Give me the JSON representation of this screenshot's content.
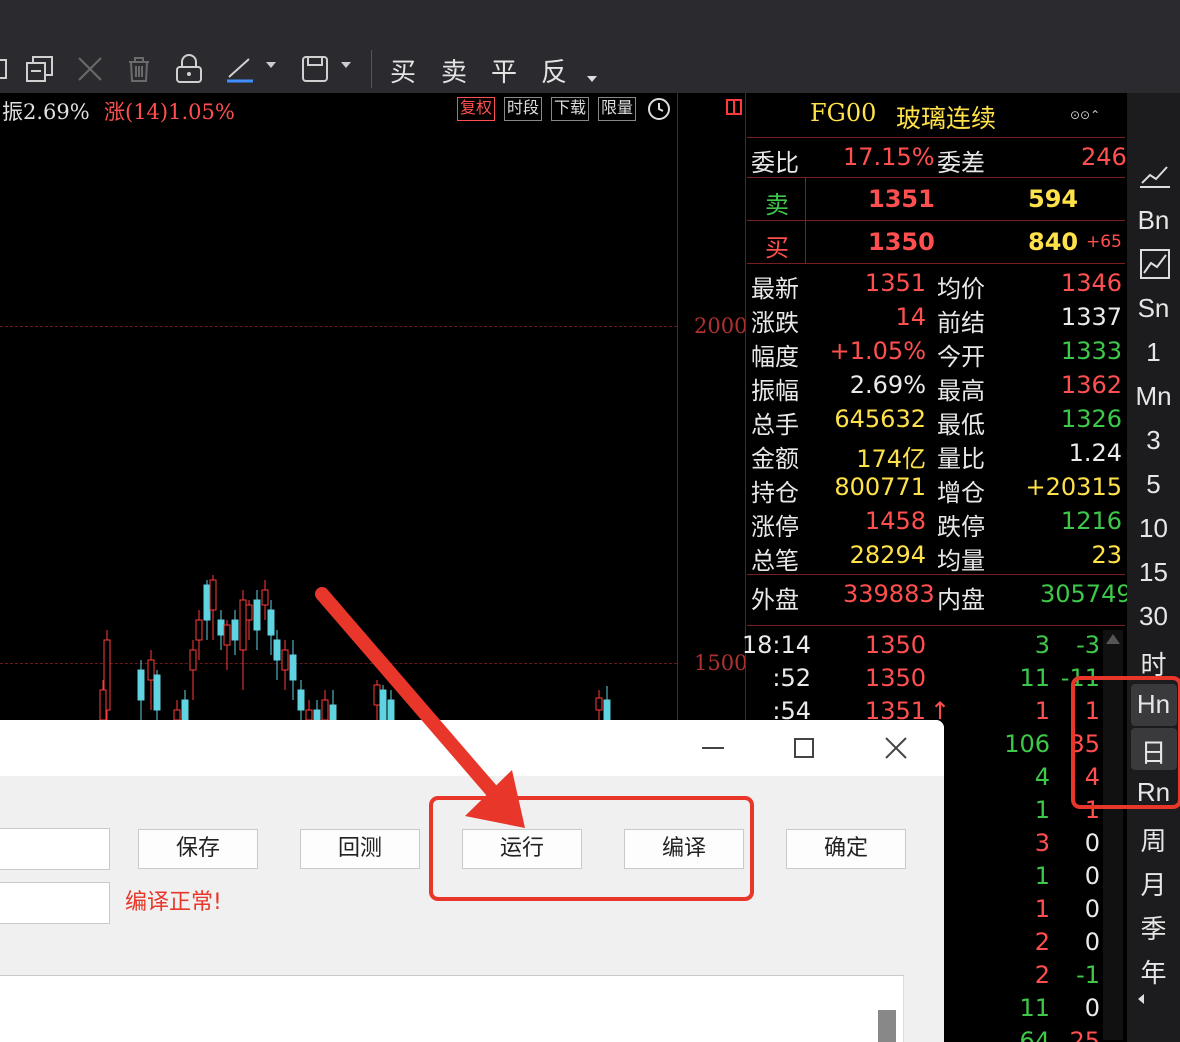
{
  "toolbar": {
    "trade_buttons": [
      "买",
      "卖",
      "平",
      "反"
    ]
  },
  "chart": {
    "amplitude_text": "振2.69%",
    "change_text": "涨(14)1.05%",
    "controls": [
      "复权",
      "时段",
      "下载",
      "限量"
    ],
    "y_labels": [
      "2000",
      "1500"
    ]
  },
  "quote": {
    "symbol": "FG00",
    "name": "玻璃连续",
    "webi_label": "委比",
    "webi_value": "17.15%",
    "weicha_label": "委差",
    "weicha_value": "246",
    "sell_label": "卖",
    "sell_price": "1351",
    "sell_volume": "594",
    "buy_label": "买",
    "buy_price": "1350",
    "buy_volume": "840",
    "buy_change": "+65",
    "stats": [
      {
        "l1": "最新",
        "v1": "1351",
        "c1": "red",
        "l2": "均价",
        "v2": "1346",
        "c2": "red"
      },
      {
        "l1": "涨跌",
        "v1": "14",
        "c1": "red",
        "l2": "前结",
        "v2": "1337",
        "c2": "white"
      },
      {
        "l1": "幅度",
        "v1": "+1.05%",
        "c1": "red",
        "l2": "今开",
        "v2": "1333",
        "c2": "green"
      },
      {
        "l1": "振幅",
        "v1": "2.69%",
        "c1": "white",
        "l2": "最高",
        "v2": "1362",
        "c2": "red"
      },
      {
        "l1": "总手",
        "v1": "645632",
        "c1": "yellow",
        "l2": "最低",
        "v2": "1326",
        "c2": "green"
      },
      {
        "l1": "金额",
        "v1": "174亿",
        "c1": "yellow",
        "l2": "量比",
        "v2": "1.24",
        "c2": "white"
      },
      {
        "l1": "持仓",
        "v1": "800771",
        "c1": "yellow",
        "l2": "增仓",
        "v2": "+20315",
        "c2": "yellow"
      },
      {
        "l1": "涨停",
        "v1": "1458",
        "c1": "red",
        "l2": "跌停",
        "v2": "1216",
        "c2": "green"
      },
      {
        "l1": "总笔",
        "v1": "28294",
        "c1": "yellow",
        "l2": "均量",
        "v2": "23",
        "c2": "yellow"
      }
    ],
    "outer_label": "外盘",
    "outer_value": "339883",
    "inner_label": "内盘",
    "inner_value": "305749"
  },
  "ticks": [
    {
      "time": "18:14",
      "price": "1350",
      "vol": "3",
      "vol_color": "green",
      "chg": "-3",
      "chg_color": "green"
    },
    {
      "time": ":52",
      "price": "1350",
      "vol": "11",
      "vol_color": "green",
      "chg": "-11",
      "chg_color": "green"
    },
    {
      "time": ":54",
      "price": "1351",
      "vol": "1",
      "vol_color": "red",
      "chg": "1",
      "chg_color": "red"
    },
    {
      "time": "",
      "price": "",
      "vol": "106",
      "vol_color": "green",
      "chg": "35",
      "chg_color": "red"
    },
    {
      "time": "",
      "price": "",
      "vol": "4",
      "vol_color": "green",
      "chg": "4",
      "chg_color": "red"
    },
    {
      "time": "",
      "price": "",
      "vol": "1",
      "vol_color": "green",
      "chg": "1",
      "chg_color": "red"
    },
    {
      "time": "",
      "price": "",
      "vol": "3",
      "vol_color": "red",
      "chg": "0",
      "chg_color": "white"
    },
    {
      "time": "",
      "price": "",
      "vol": "1",
      "vol_color": "green",
      "chg": "0",
      "chg_color": "white"
    },
    {
      "time": "",
      "price": "",
      "vol": "1",
      "vol_color": "red",
      "chg": "0",
      "chg_color": "white"
    },
    {
      "time": "",
      "price": "",
      "vol": "2",
      "vol_color": "red",
      "chg": "0",
      "chg_color": "white"
    },
    {
      "time": "",
      "price": "",
      "vol": "2",
      "vol_color": "red",
      "chg": "-1",
      "chg_color": "green"
    },
    {
      "time": "",
      "price": "",
      "vol": "11",
      "vol_color": "green",
      "chg": "0",
      "chg_color": "white"
    },
    {
      "time": "",
      "price": "",
      "vol": "64",
      "vol_color": "green",
      "chg": "25",
      "chg_color": "red"
    }
  ],
  "periods": [
    "Bn",
    "Sn",
    "1",
    "Mn",
    "3",
    "5",
    "10",
    "15",
    "30",
    "时",
    "Hn",
    "日",
    "Rn",
    "周",
    "月",
    "季",
    "年"
  ],
  "dialog": {
    "buttons": [
      "保存",
      "回测",
      "运行",
      "编译",
      "确定"
    ],
    "status": "编译正常!"
  },
  "colors": {
    "annotation": "#e8362a",
    "up": "#ff4f4f",
    "down": "#3ec84a",
    "volume": "#ffe14a",
    "candle_down": "#5fd3e0"
  }
}
